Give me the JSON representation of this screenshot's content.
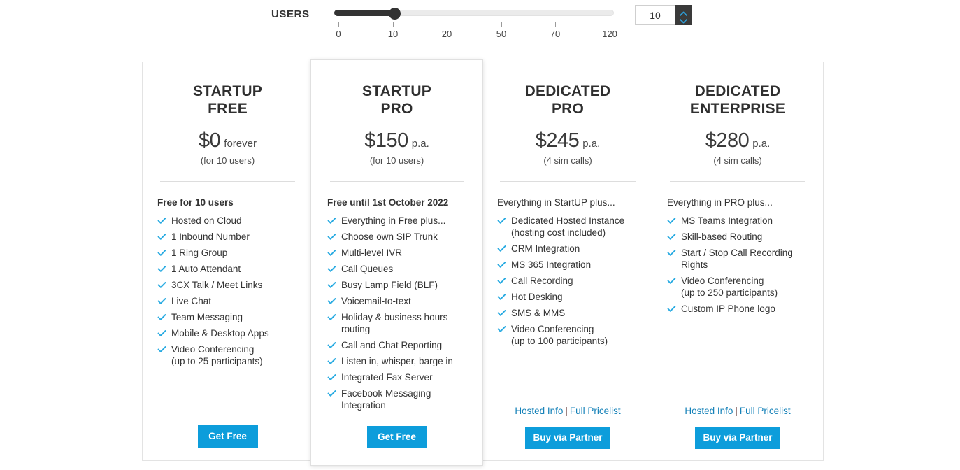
{
  "slider": {
    "label": "USERS",
    "value": "10",
    "ticks": [
      "0",
      "10",
      "20",
      "50",
      "70",
      "120"
    ],
    "fill_percent": 22,
    "up_icon": "chevron-up-icon",
    "down_icon": "chevron-down-icon",
    "accent": "#0d9ddb",
    "track_fill_color": "#333333"
  },
  "cards": [
    {
      "name": "STARTUP\nFREE",
      "name_line1": "STARTUP",
      "name_line2": "FREE",
      "price": "$0",
      "period": "forever",
      "sub": "(for 10 users)",
      "intro": "Free for 10 users",
      "intro_bold": true,
      "features": [
        {
          "line1": "Hosted on Cloud"
        },
        {
          "line1": "1 Inbound Number"
        },
        {
          "line1": "1 Ring Group"
        },
        {
          "line1": "1 Auto Attendant"
        },
        {
          "line1": "3CX Talk / Meet Links"
        },
        {
          "line1": "Live Chat"
        },
        {
          "line1": "Team Messaging"
        },
        {
          "line1": "Mobile & Desktop Apps"
        },
        {
          "line1": "Video Conferencing",
          "line2": "(up to 25 participants)"
        }
      ],
      "links": null,
      "button": "Get Free"
    },
    {
      "name": "STARTUP\nPRO",
      "name_line1": "STARTUP",
      "name_line2": "PRO",
      "price": "$150",
      "period": "p.a.",
      "sub": "(for 10 users)",
      "intro": "Free until 1st October 2022",
      "intro_bold": true,
      "features": [
        {
          "line1": "Everything in Free plus..."
        },
        {
          "line1": "Choose own SIP Trunk"
        },
        {
          "line1": "Multi-level IVR"
        },
        {
          "line1": "Call Queues"
        },
        {
          "line1": "Busy Lamp Field (BLF)"
        },
        {
          "line1": "Voicemail-to-text"
        },
        {
          "line1": "Holiday & business hours",
          "line2": "routing"
        },
        {
          "line1": "Call and Chat Reporting"
        },
        {
          "line1": "Listen in, whisper, barge in"
        },
        {
          "line1": "Integrated Fax Server"
        },
        {
          "line1": "Facebook Messaging",
          "line2": "Integration"
        }
      ],
      "links": null,
      "button": "Get Free"
    },
    {
      "name": "DEDICATED\nPRO",
      "name_line1": "DEDICATED",
      "name_line2": "PRO",
      "price": "$245",
      "period": "p.a.",
      "sub": "(4 sim calls)",
      "intro": "Everything in StartUP plus...",
      "intro_bold": false,
      "features": [
        {
          "line1": "Dedicated Hosted Instance",
          "line2": "(hosting cost included)"
        },
        {
          "line1": "CRM Integration"
        },
        {
          "line1": "MS 365 Integration"
        },
        {
          "line1": "Call Recording"
        },
        {
          "line1": "Hot Desking"
        },
        {
          "line1": "SMS & MMS"
        },
        {
          "line1": "Video Conferencing",
          "line2": "(up to 100 participants)"
        }
      ],
      "links": {
        "left": "Hosted Info",
        "sep": "|",
        "right": "Full Pricelist"
      },
      "button": "Buy via Partner"
    },
    {
      "name": "DEDICATED\nENTERPRISE",
      "name_line1": "DEDICATED",
      "name_line2": "ENTERPRISE",
      "price": "$280",
      "period": "p.a.",
      "sub": "(4 sim calls)",
      "intro": "Everything in PRO plus...",
      "intro_bold": false,
      "features": [
        {
          "line1": "MS Teams Integration",
          "caret": true
        },
        {
          "line1": "Skill-based Routing"
        },
        {
          "line1": "Start / Stop Call Recording",
          "line2": "Rights"
        },
        {
          "line1": "Video Conferencing",
          "line2": "(up to 250 participants)"
        },
        {
          "line1": "Custom IP Phone logo"
        }
      ],
      "links": {
        "left": "Hosted Info",
        "sep": "|",
        "right": "Full Pricelist"
      },
      "button": "Buy via Partner"
    }
  ]
}
